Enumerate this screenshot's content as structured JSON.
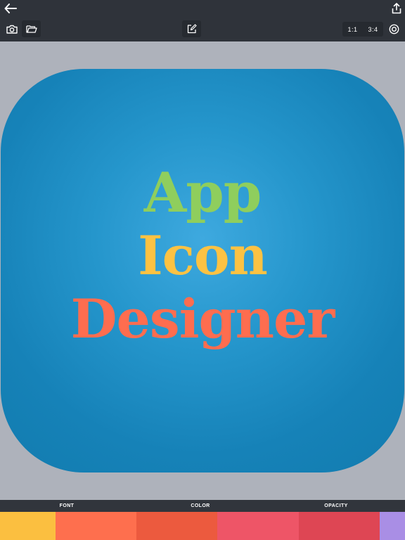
{
  "icons": {
    "back": "arrow-left-icon",
    "share": "share-upload-icon",
    "camera": "camera-icon",
    "folder": "folder-open-icon",
    "edit": "edit-pencil-icon",
    "settings": "gear-ring-icon"
  },
  "toolbar": {
    "ratios": [
      "1:1",
      "3:4"
    ]
  },
  "canvas": {
    "icon_text": {
      "line1": "App",
      "line2": "Icon",
      "line3": "Designer"
    },
    "colors": {
      "line1": "#8fce5d",
      "line2": "#fcc243",
      "line3": "#fe6d4f",
      "tile": "#1a87bd"
    }
  },
  "bottom_tabs": {
    "font": "FONT",
    "color": "COLOR",
    "opacity": "OPACITY"
  },
  "palette": [
    "#fbbf40",
    "#fe6f4e",
    "#ec5a3e",
    "#ee5567",
    "#de4654",
    "#a98ee5"
  ]
}
